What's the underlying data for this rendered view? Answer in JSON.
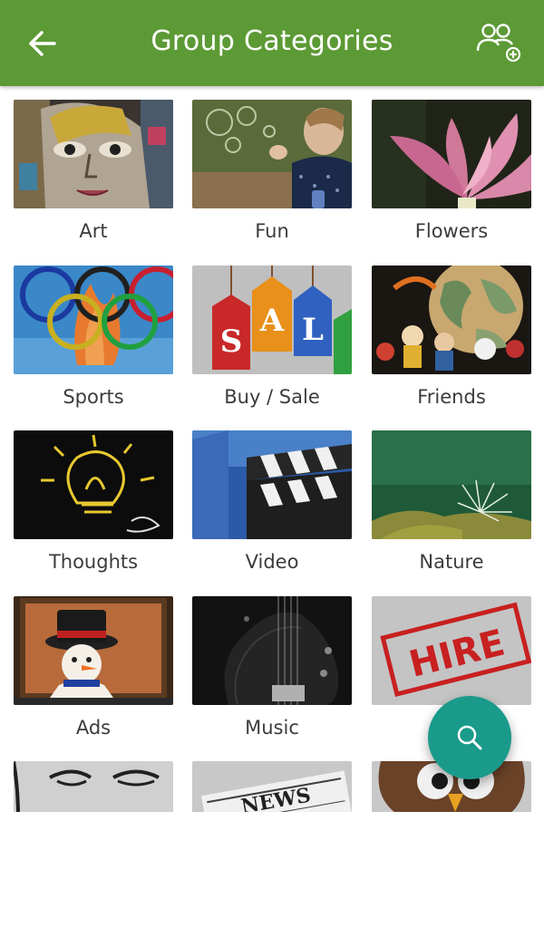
{
  "header": {
    "title": "Group Categories",
    "back_icon": "arrow-left-icon",
    "action_icon": "add-group-icon",
    "background": "#5c9a35"
  },
  "categories": [
    {
      "label": "Art",
      "image": "graffiti-face"
    },
    {
      "label": "Fun",
      "image": "child-blowing-bubbles"
    },
    {
      "label": "Flowers",
      "image": "lotus-flower"
    },
    {
      "label": "Sports",
      "image": "olympic-rings"
    },
    {
      "label": "Buy / Sale",
      "image": "sale-tags"
    },
    {
      "label": "Friends",
      "image": "globe-with-figurines"
    },
    {
      "label": "Thoughts",
      "image": "lightbulb-sketch"
    },
    {
      "label": "Video",
      "image": "clapperboard"
    },
    {
      "label": "Nature",
      "image": "moss-and-seedhead"
    },
    {
      "label": "Ads",
      "image": "snowman-in-suitcase"
    },
    {
      "label": "Music",
      "image": "electric-guitar"
    },
    {
      "label": "",
      "image": "hire-stamp"
    },
    {
      "label": "",
      "image": "cartoon-face"
    },
    {
      "label": "",
      "image": "newspaper"
    },
    {
      "label": "",
      "image": "cartoon-owl"
    }
  ],
  "fab": {
    "icon": "search-icon",
    "color": "#1a9a8a"
  }
}
